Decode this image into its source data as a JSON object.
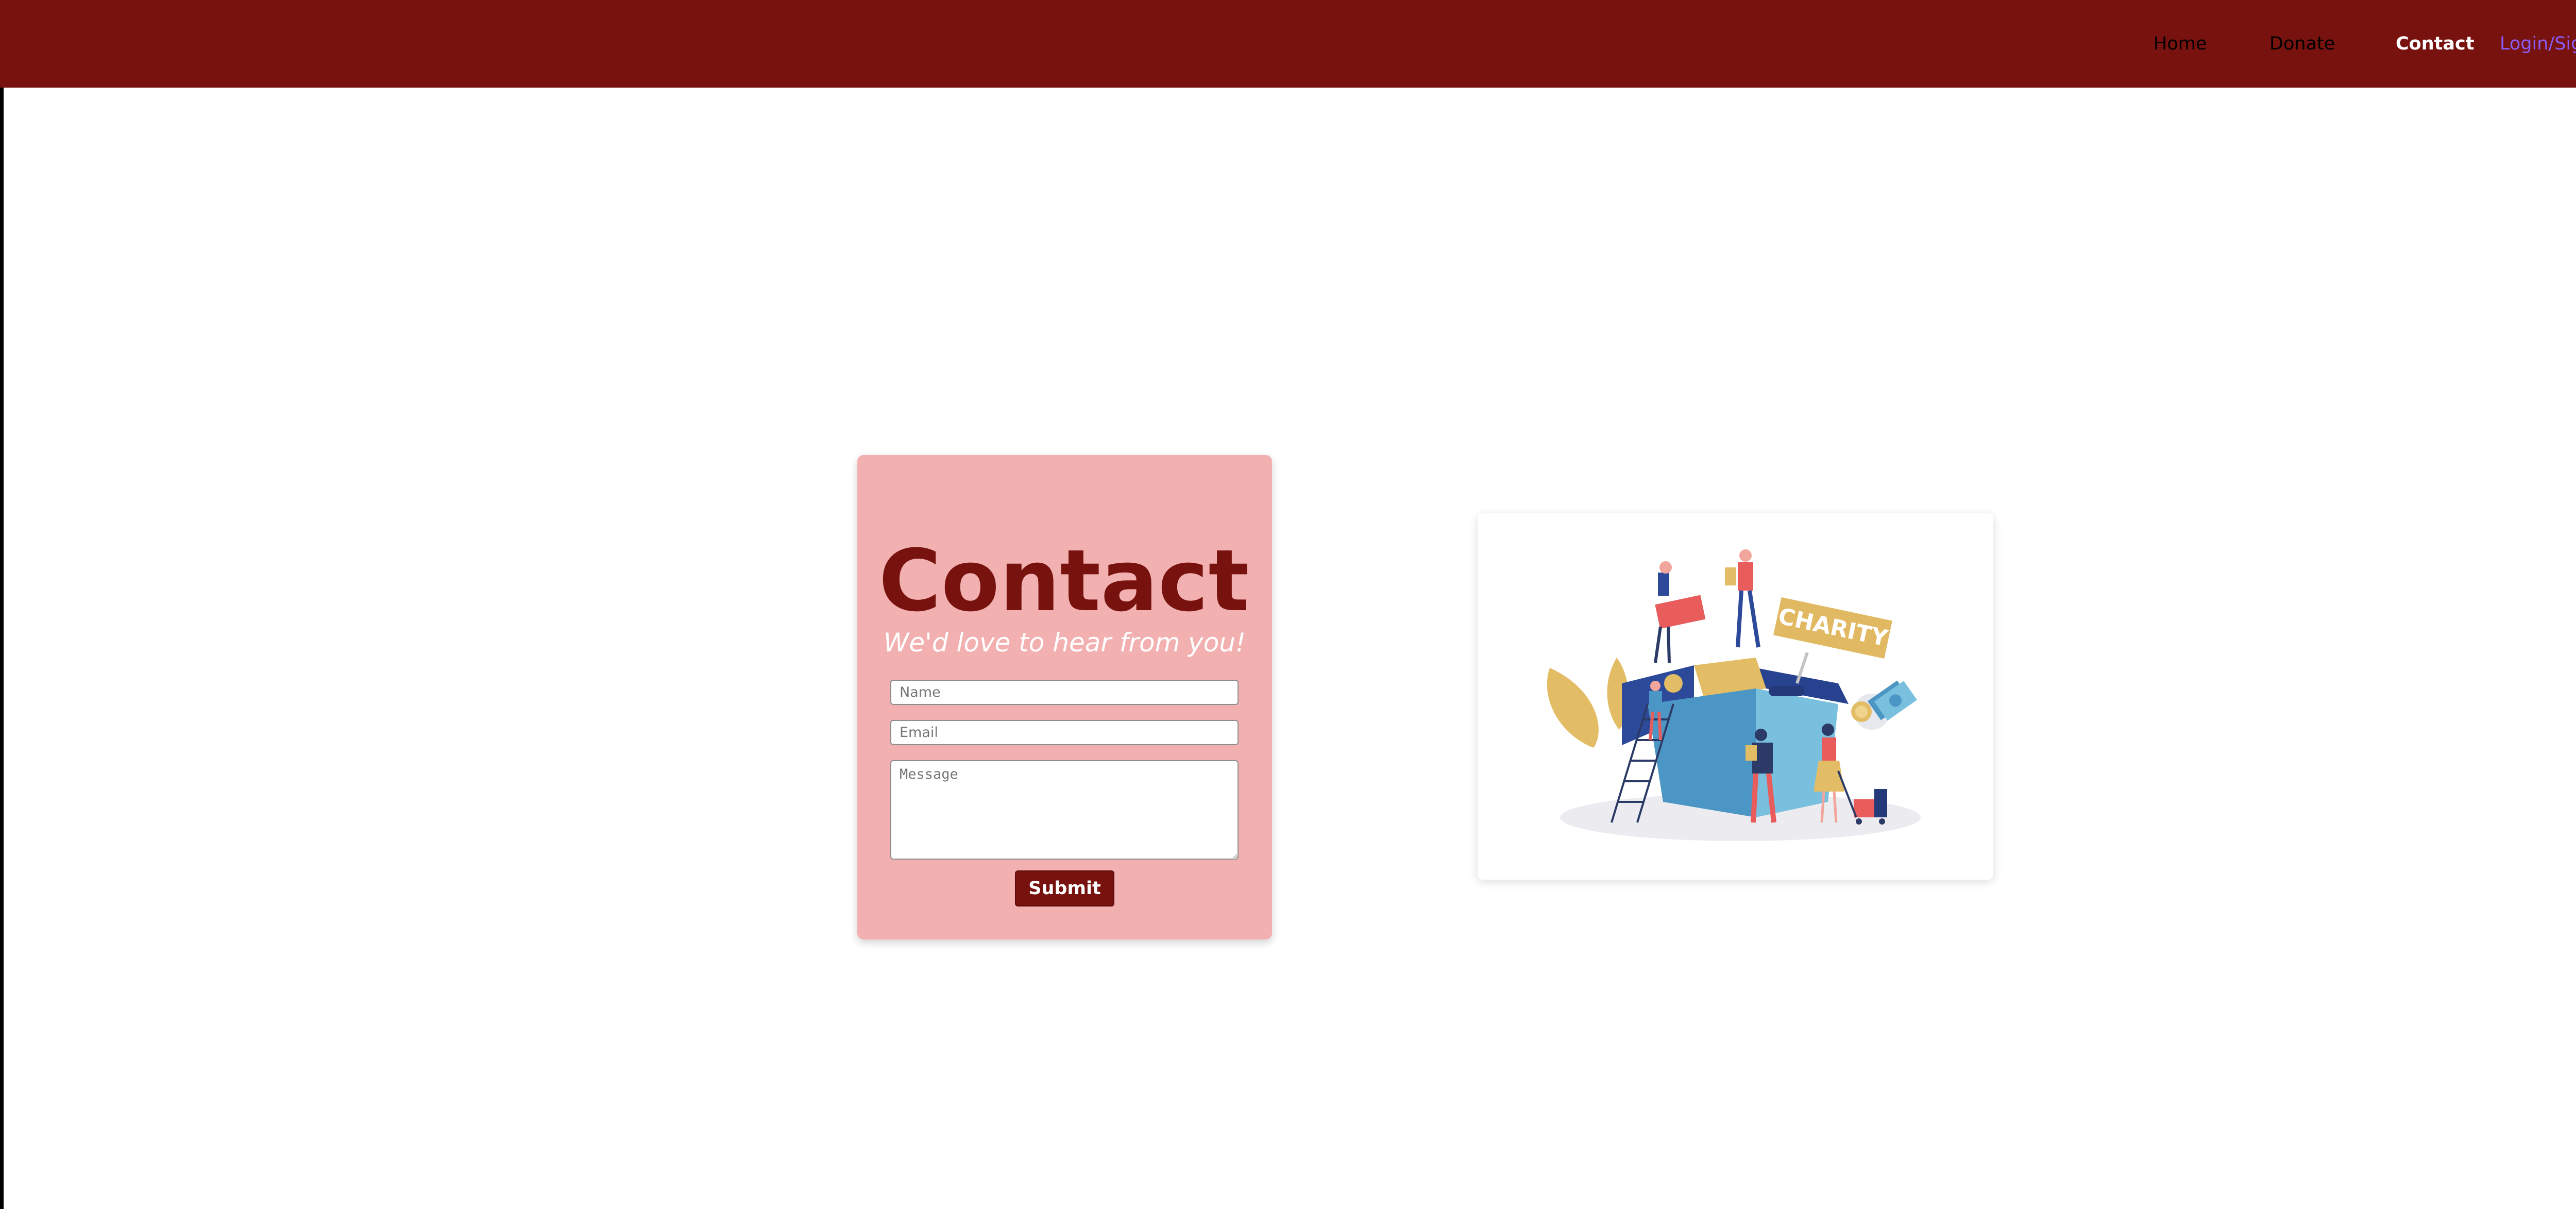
{
  "nav": {
    "home": "Home",
    "donate": "Donate",
    "contact": "Contact",
    "login": "Login/Sign Up"
  },
  "contact": {
    "title": "Contact",
    "subtitle": "We'd love to hear from you!",
    "name_placeholder": "Name",
    "email_placeholder": "Email",
    "message_placeholder": "Message",
    "submit_label": "Submit"
  },
  "illustration": {
    "sign_text": "CHARITY"
  },
  "colors": {
    "brand": "#77120f",
    "card": "#f2b1b0",
    "active_nav": "#ffffff",
    "login_link": "#8b5cf6"
  }
}
